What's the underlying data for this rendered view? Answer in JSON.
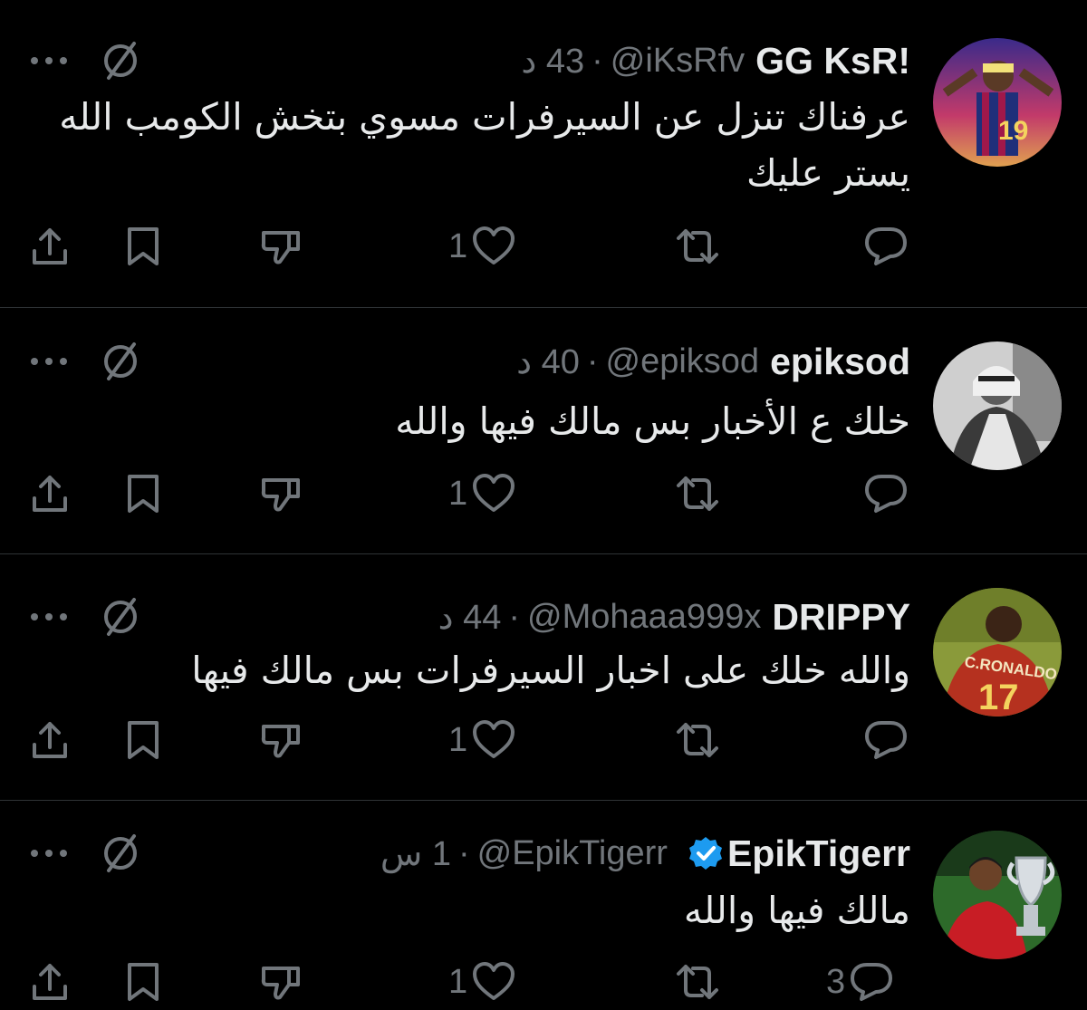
{
  "tweets": [
    {
      "display_name": "GG KsR!",
      "handle": "@iKsRfv",
      "time": "43 د",
      "verified": false,
      "text": "عرفناك تنزل عن السيرفرات مسوي بتخش الكومب الله يستر عليك",
      "reply_count": "",
      "like_count": "1",
      "avatar": "footballer-celebrating-avatar"
    },
    {
      "display_name": "epiksod",
      "handle": "@epiksod",
      "time": "40 د",
      "verified": false,
      "text": "خلك ع الأخبار بس مالك فيها والله",
      "reply_count": "",
      "like_count": "1",
      "avatar": "man-in-thobe-avatar"
    },
    {
      "display_name": "DRIPPY",
      "handle": "@Mohaaa999x",
      "time": "44 د",
      "verified": false,
      "text": "والله خلك على اخبار السيرفرات بس مالك فيها",
      "reply_count": "",
      "like_count": "1",
      "avatar": "c-ronaldo-17-jersey-avatar"
    },
    {
      "display_name": "EpikTigerr",
      "handle": "@EpikTigerr",
      "time": "1 س",
      "verified": true,
      "text": "مالك فيها والله",
      "reply_count": "3",
      "like_count": "1",
      "avatar": "player-with-trophy-avatar"
    }
  ],
  "colors": {
    "background": "#000000",
    "text": "#e7e9ea",
    "muted": "#71767b",
    "divider": "#2f3336",
    "verified": "#1d9bf0"
  },
  "separator": "·"
}
